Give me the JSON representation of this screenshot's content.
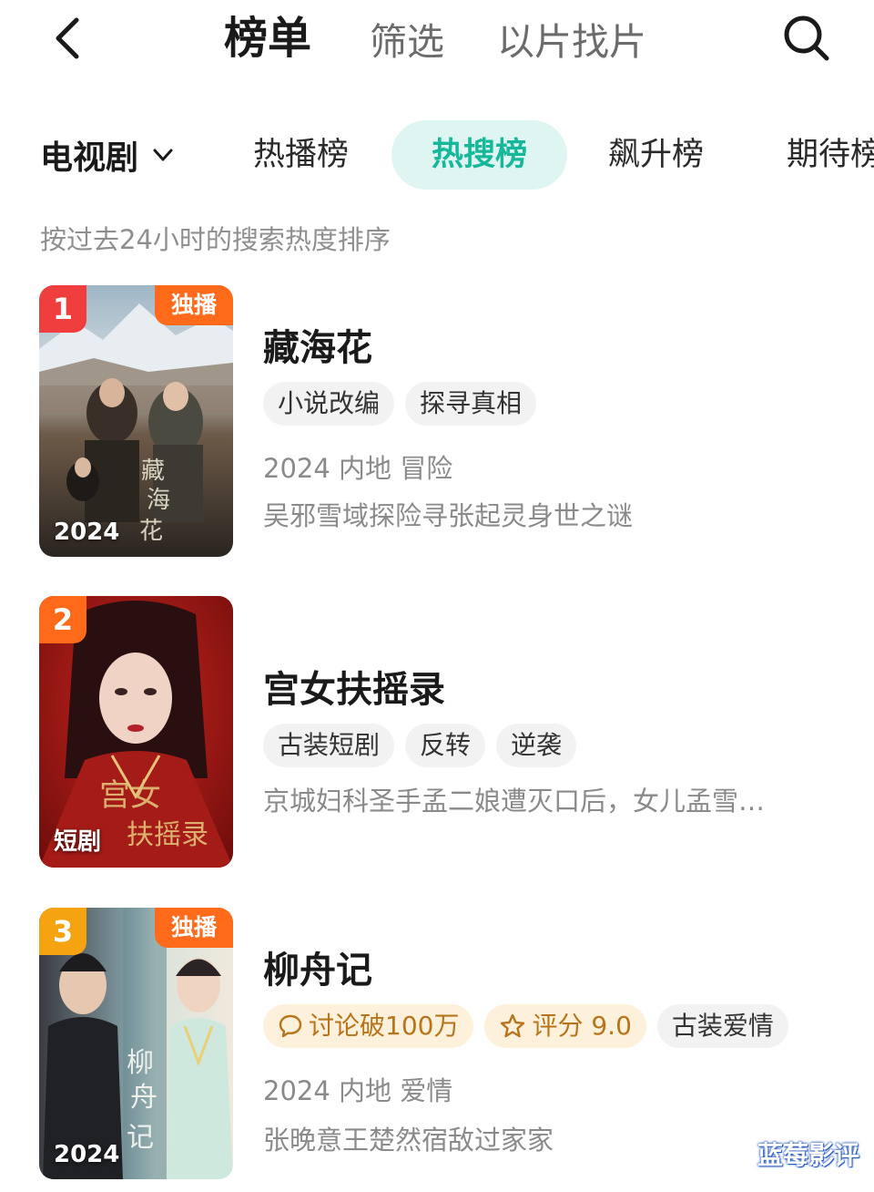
{
  "nav": {
    "tabs": [
      {
        "label": "榜单"
      },
      {
        "label": "筛选"
      },
      {
        "label": "以片找片"
      }
    ]
  },
  "category": {
    "selected": "电视剧",
    "tabs": [
      {
        "label": "热播榜"
      },
      {
        "label": "热搜榜"
      },
      {
        "label": "飙升榜"
      },
      {
        "label": "期待榜"
      }
    ]
  },
  "subtitle": "按过去24小时的搜索热度排序",
  "items": [
    {
      "rank": "1",
      "badge": "独播",
      "poster_label": "2024",
      "title": "藏海花",
      "tags": [
        "小说改编",
        "探寻真相"
      ],
      "meta": "2024 内地 冒险",
      "desc": "吴邪雪域探险寻张起灵身世之谜"
    },
    {
      "rank": "2",
      "badge": "",
      "poster_label": "短剧",
      "title": "宫女扶摇录",
      "tags": [
        "古装短剧",
        "反转",
        "逆袭"
      ],
      "desc": "京城妇科圣手孟二娘遭灭口后，女儿孟雪…"
    },
    {
      "rank": "3",
      "badge": "独播",
      "poster_label": "2024",
      "title": "柳舟记",
      "hot_tags": [
        "讨论破100万",
        "评分 9.0"
      ],
      "tags": [
        "古装爱情"
      ],
      "meta": "2024 内地 爱情",
      "desc": "张晚意王楚然宿敌过家家"
    }
  ],
  "watermark": "蓝莓影评",
  "colors": {
    "accent": "#17b89a",
    "accent_bg": "#dff5f1",
    "rank1": "#f03e3e",
    "rank2": "#ff6a1a",
    "rank3": "#f5a310",
    "exclusive": "#ff6b1a",
    "hot_tag_bg": "#fdf1dc",
    "hot_tag_text": "#b8741a"
  }
}
